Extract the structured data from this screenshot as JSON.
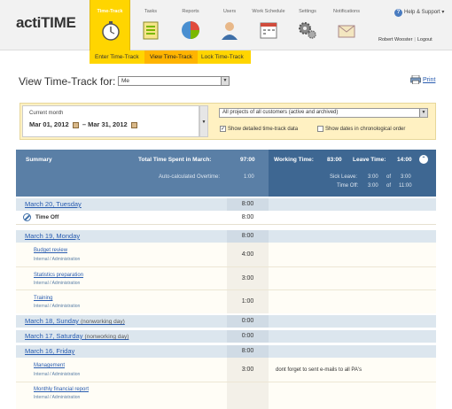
{
  "app": {
    "logo": "actiTIME"
  },
  "nav": [
    {
      "label": "Time-Track"
    },
    {
      "label": "Tasks"
    },
    {
      "label": "Reports"
    },
    {
      "label": "Users"
    },
    {
      "label": "Work Schedule"
    },
    {
      "label": "Settings"
    },
    {
      "label": "Notifications"
    }
  ],
  "header": {
    "help": "Help & Support",
    "user_name": "Robert Wooster",
    "logout": "Logout"
  },
  "subnav": [
    {
      "label": "Enter Time-Track"
    },
    {
      "label": "View Time-Track"
    },
    {
      "label": "Lock Time-Track"
    }
  ],
  "page": {
    "title": "View Time-Track for:",
    "user_select": "Me",
    "print": "Print"
  },
  "filter": {
    "period_label": "Current month",
    "date_from": "Mar 01, 2012",
    "date_sep": "–",
    "date_to": "Mar 31, 2012",
    "projects_select": "All projects of all customers (active and archived)",
    "show_details": "Show detailed time-track data",
    "show_details_checked": true,
    "chronological": "Show dates in chronological order",
    "chronological_checked": false
  },
  "summary": {
    "title": "Summary",
    "total_label": "Total Time Spent in March:",
    "total_value": "97:00",
    "overtime_label": "Auto-calculated Overtime:",
    "overtime_value": "1:00",
    "working_label": "Working Time:",
    "working_value": "83:00",
    "leave_label": "Leave Time:",
    "leave_value": "14:00",
    "sick_label": "Sick Leave:",
    "sick_value": "3:00",
    "sick_of": "of",
    "sick_total": "3:00",
    "timeoff_label": "Time Off:",
    "timeoff_value": "3:00",
    "timeoff_of": "of",
    "timeoff_total": "11:00"
  },
  "days": [
    {
      "date": "March 20, Tuesday",
      "note": "",
      "total": "8:00",
      "items": [
        {
          "type": "timeoff",
          "name": "Time Off",
          "time": "8:00"
        }
      ]
    },
    {
      "date": "March 19, Monday",
      "note": "",
      "total": "8:00",
      "items": [
        {
          "name": "Budget review",
          "customer": "Internal",
          "project": "Administration",
          "time": "4:00",
          "comment": ""
        },
        {
          "name": "Statistics preparation",
          "customer": "Internal",
          "project": "Administration",
          "time": "3:00",
          "comment": ""
        },
        {
          "name": "Training",
          "customer": "Internal",
          "project": "Administration",
          "time": "1:00",
          "comment": ""
        }
      ]
    },
    {
      "date": "March 18, Sunday",
      "note": "(nonworking day)",
      "total": "0:00",
      "items": []
    },
    {
      "date": "March 17, Saturday",
      "note": "(nonworking day)",
      "total": "0:00",
      "items": []
    },
    {
      "date": "March 16, Friday",
      "note": "",
      "total": "8:00",
      "items": [
        {
          "name": "Management",
          "customer": "Internal",
          "project": "Administration",
          "time": "3:00",
          "comment": "dont forget to sent e-mails to all PA's"
        },
        {
          "name": "Monthly financial report",
          "customer": "Internal",
          "project": "Administration",
          "time": "",
          "comment": ""
        }
      ]
    }
  ],
  "colors": {
    "accent": "#ffd500",
    "summary_bg": "#5a7fa6",
    "summary_dark": "#3e6792",
    "link": "#2a5db0"
  }
}
